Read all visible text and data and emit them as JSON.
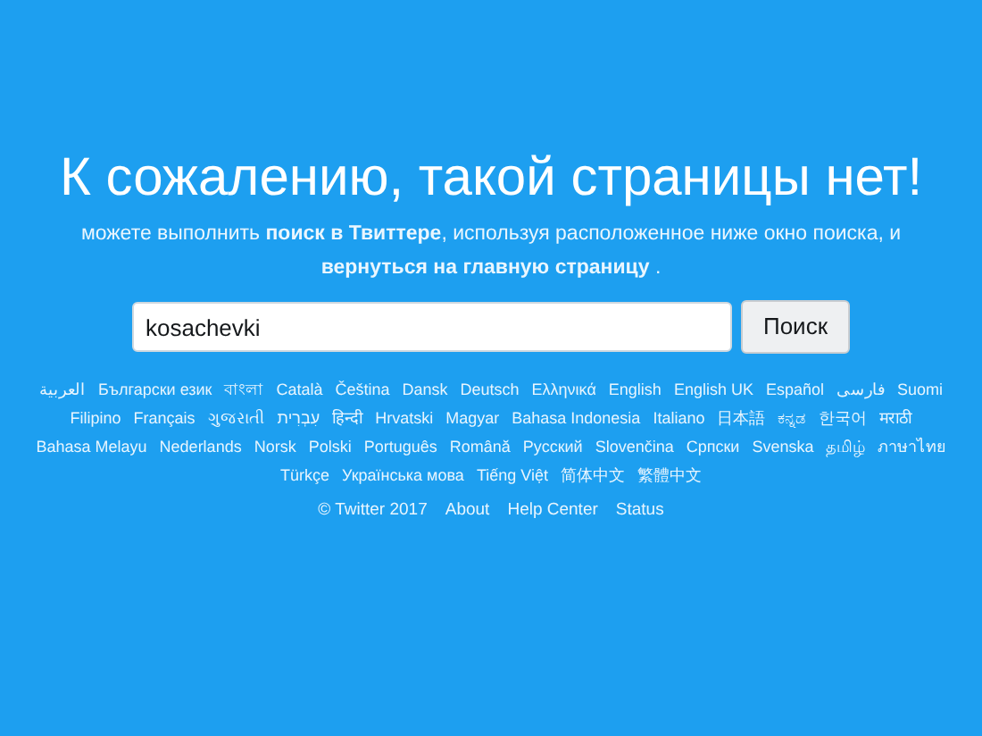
{
  "title": "К сожалению, такой страницы нет!",
  "message_lines": [
    "можете выполнить **поиск в Твиттере**, используя расположенное ниже окно поиска, и",
    "**вернуться на главную страницу** ."
  ],
  "search": {
    "value": "kosachevki",
    "button": "Поиск"
  },
  "language_rows": [
    [
      "العربية",
      "Български език",
      "বাংলা",
      "Català",
      "Čeština",
      "Dansk",
      "Deutsch",
      "Ελληνικά",
      "English",
      "English UK",
      "Español",
      "فارسی",
      "Suomi"
    ],
    [
      "Filipino",
      "Français",
      "ગુજરાતી",
      "עִבְרִית",
      "हिन्दी",
      "Hrvatski",
      "Magyar",
      "Bahasa Indonesia",
      "Italiano",
      "日本語",
      "ಕನ್ನಡ",
      "한국어",
      "मराठी"
    ],
    [
      "Bahasa Melayu",
      "Nederlands",
      "Norsk",
      "Polski",
      "Português",
      "Română",
      "Русский",
      "Slovenčina",
      "Српски",
      "Svenska",
      "தமிழ்",
      "ภาษาไทย"
    ],
    [
      "Türkçe",
      "Українська мова",
      "Tiếng Việt",
      "简体中文",
      "繁體中文"
    ]
  ],
  "footer": {
    "copyright": "© Twitter 2017",
    "links": [
      "About",
      "Help Center",
      "Status"
    ]
  }
}
